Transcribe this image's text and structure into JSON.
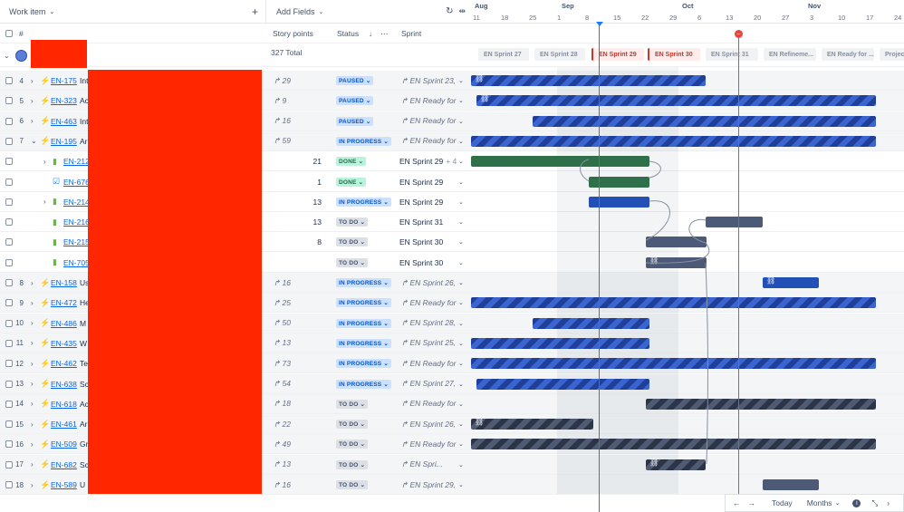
{
  "header": {
    "work_item": "Work item",
    "add_fields": "Add Fields",
    "story_points": "Story points",
    "status": "Status",
    "sprint": "Sprint",
    "hash": "#",
    "total": "327 Total"
  },
  "timeline": {
    "months": [
      "Aug",
      "Sep",
      "Oct",
      "Nov"
    ],
    "ticks": [
      "11",
      "18",
      "25",
      "1",
      "8",
      "15",
      "22",
      "29",
      "6",
      "13",
      "20",
      "27",
      "3",
      "10",
      "17",
      "24"
    ],
    "sprints": [
      "EN Sprint 27",
      "EN Sprint 28",
      "EN Sprint 29",
      "EN Sprint 30",
      "EN Sprint 31",
      "EN Refineme...",
      "EN Ready for ...",
      "Projec"
    ]
  },
  "rows": [
    {
      "num": "4",
      "key": "EN-175",
      "title": "Int",
      "points": "29",
      "status": "PAUSED",
      "sprint": "EN Sprint 23,",
      "indent": 0,
      "icon": "epic"
    },
    {
      "num": "5",
      "key": "EN-323",
      "title": "Ac",
      "points": "9",
      "status": "PAUSED",
      "sprint": "EN Ready for",
      "indent": 0,
      "icon": "epic"
    },
    {
      "num": "6",
      "key": "EN-463",
      "title": "Int",
      "points": "16",
      "status": "PAUSED",
      "sprint": "EN Ready for",
      "indent": 0,
      "icon": "epic"
    },
    {
      "num": "7",
      "key": "EN-195",
      "title": "Ar",
      "points": "59",
      "status": "IN PROGRESS",
      "sprint": "EN Ready for",
      "indent": 0,
      "icon": "epic"
    },
    {
      "num": "",
      "key": "EN-212",
      "title": "",
      "points": "21",
      "status": "DONE",
      "sprint": "EN Sprint 29",
      "sprint_extra": "+ 4",
      "indent": 1,
      "icon": "story"
    },
    {
      "num": "",
      "key": "EN-676",
      "title": "",
      "points": "1",
      "status": "DONE",
      "sprint": "EN Sprint 29",
      "indent": 1,
      "icon": "task"
    },
    {
      "num": "",
      "key": "EN-214",
      "title": "",
      "points": "13",
      "status": "IN PROGRESS",
      "sprint": "EN Sprint 29",
      "indent": 1,
      "icon": "story"
    },
    {
      "num": "",
      "key": "EN-216",
      "title": "",
      "points": "13",
      "status": "TO DO",
      "sprint": "EN Sprint 31",
      "indent": 1,
      "icon": "story"
    },
    {
      "num": "",
      "key": "EN-215",
      "title": "",
      "points": "8",
      "status": "TO DO",
      "sprint": "EN Sprint 30",
      "indent": 1,
      "icon": "story"
    },
    {
      "num": "",
      "key": "EN-705",
      "title": "",
      "points": "",
      "status": "TO DO",
      "sprint": "EN Sprint 30",
      "indent": 1,
      "icon": "story"
    },
    {
      "num": "8",
      "key": "EN-158",
      "title": "Us",
      "points": "16",
      "status": "IN PROGRESS",
      "sprint": "EN Sprint 26,",
      "indent": 0,
      "icon": "epic"
    },
    {
      "num": "9",
      "key": "EN-472",
      "title": "He",
      "points": "25",
      "status": "IN PROGRESS",
      "sprint": "EN Ready for",
      "indent": 0,
      "icon": "epic"
    },
    {
      "num": "10",
      "key": "EN-486",
      "title": "M",
      "points": "50",
      "status": "IN PROGRESS",
      "sprint": "EN Sprint 28,",
      "indent": 0,
      "icon": "epic"
    },
    {
      "num": "11",
      "key": "EN-435",
      "title": "W",
      "points": "13",
      "status": "IN PROGRESS",
      "sprint": "EN Sprint 25,",
      "indent": 0,
      "icon": "epic"
    },
    {
      "num": "12",
      "key": "EN-462",
      "title": "Te",
      "points": "73",
      "status": "IN PROGRESS",
      "sprint": "EN Ready for",
      "indent": 0,
      "icon": "epic"
    },
    {
      "num": "13",
      "key": "EN-638",
      "title": "Sc",
      "points": "54",
      "status": "IN PROGRESS",
      "sprint": "EN Sprint 27,",
      "indent": 0,
      "icon": "epic"
    },
    {
      "num": "14",
      "key": "EN-618",
      "title": "Ac",
      "points": "18",
      "status": "TO DO",
      "sprint": "EN Ready for",
      "indent": 0,
      "icon": "epic"
    },
    {
      "num": "15",
      "key": "EN-461",
      "title": "Ar",
      "points": "22",
      "status": "TO DO",
      "sprint": "EN Sprint 26,",
      "indent": 0,
      "icon": "epic"
    },
    {
      "num": "16",
      "key": "EN-509",
      "title": "Gr",
      "points": "49",
      "status": "TO DO",
      "sprint": "EN Ready for",
      "indent": 0,
      "icon": "epic"
    },
    {
      "num": "17",
      "key": "EN-682",
      "title": "Sc",
      "points": "13",
      "status": "TO DO",
      "sprint": "EN Spri...",
      "indent": 0,
      "icon": "epic"
    },
    {
      "num": "18",
      "key": "EN-589",
      "title": "U",
      "points": "16",
      "status": "TO DO",
      "sprint": "EN Sprint 29,",
      "indent": 0,
      "icon": "epic"
    }
  ],
  "footer": {
    "today": "Today",
    "months": "Months"
  }
}
